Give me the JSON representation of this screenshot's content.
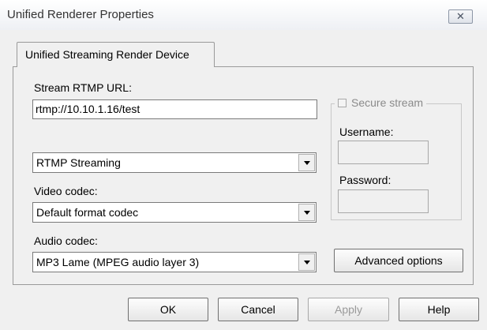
{
  "window": {
    "title": "Unified Renderer Properties",
    "close_glyph": "✕"
  },
  "tab": {
    "label": "Unified Streaming Render Device"
  },
  "stream": {
    "url_label": "Stream RTMP URL:",
    "url_value": "rtmp://10.10.1.16/test",
    "protocol_value": "RTMP Streaming"
  },
  "video": {
    "label": "Video codec:",
    "value": "Default format codec"
  },
  "audio": {
    "label": "Audio codec:",
    "value": "MP3 Lame (MPEG audio layer 3)"
  },
  "secure": {
    "label": "Secure stream",
    "checked": false,
    "username_label": "Username:",
    "username_value": "",
    "password_label": "Password:",
    "password_value": ""
  },
  "buttons": {
    "advanced": "Advanced options",
    "ok": "OK",
    "cancel": "Cancel",
    "apply": "Apply",
    "help": "Help"
  }
}
